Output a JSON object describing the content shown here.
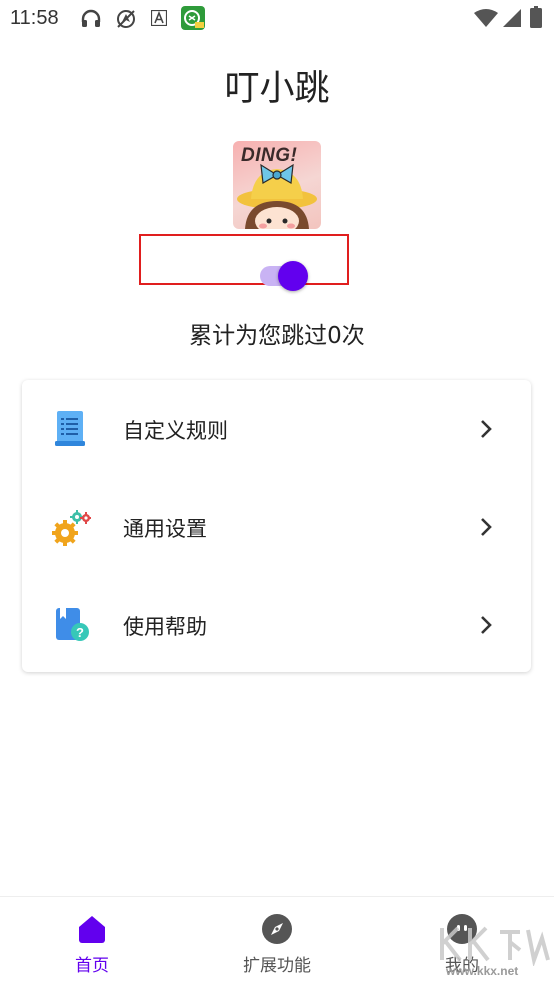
{
  "status_bar": {
    "time": "11:58",
    "left_icons": [
      "headphones-icon",
      "no-location-icon",
      "font-a-icon",
      "app-notification-icon"
    ],
    "right_icons": [
      "wifi-icon",
      "signal-icon",
      "battery-icon"
    ]
  },
  "app": {
    "title": "叮小跳",
    "logo_text": "DING!"
  },
  "main_switch": {
    "state": "on"
  },
  "skip_count_text": "累计为您跳过0次",
  "menu": {
    "items": [
      {
        "label": "自定义规则",
        "icon": "document-icon"
      },
      {
        "label": "通用设置",
        "icon": "gears-icon"
      },
      {
        "label": "使用帮助",
        "icon": "help-book-icon"
      }
    ]
  },
  "bottom_nav": {
    "items": [
      {
        "label": "首页",
        "icon": "home-icon",
        "active": true
      },
      {
        "label": "扩展功能",
        "icon": "compass-icon",
        "active": false
      },
      {
        "label": "我的",
        "icon": "profile-icon",
        "active": false
      }
    ]
  },
  "watermark": {
    "text": "www.kkx.net"
  },
  "colors": {
    "accent": "#6200ee",
    "switch_track": "#c9b3f4",
    "highlight_border": "#e01e1e",
    "text_primary": "#222222"
  }
}
